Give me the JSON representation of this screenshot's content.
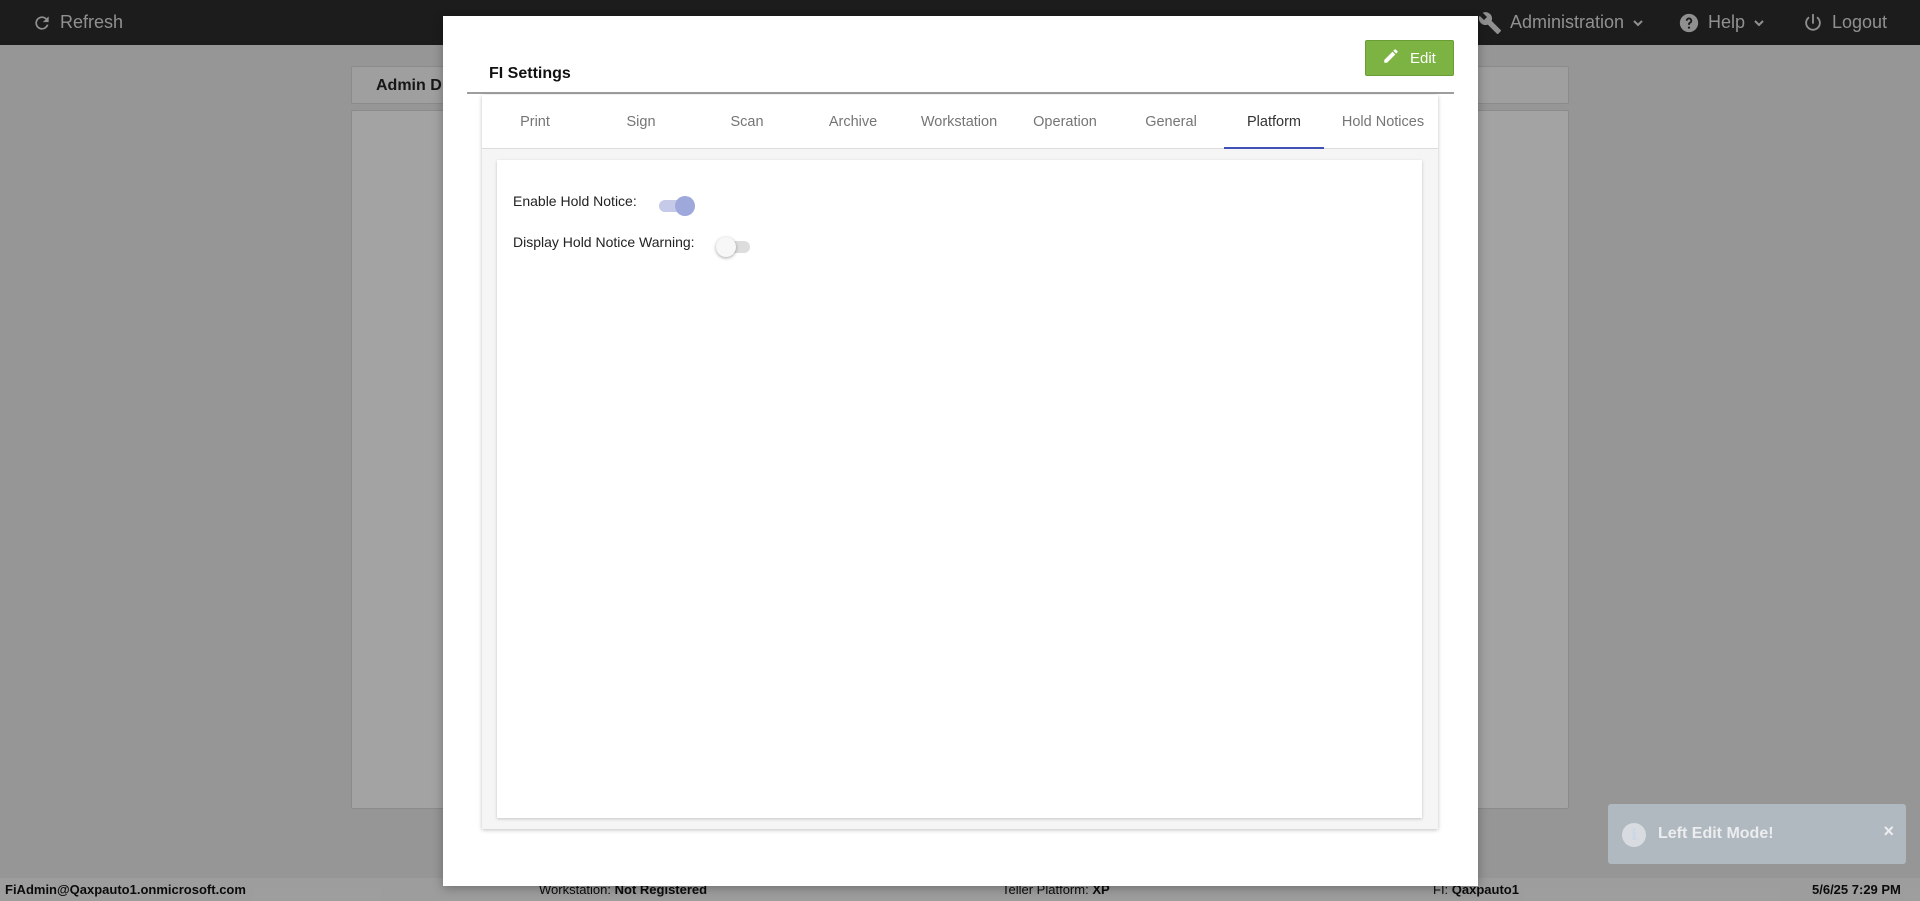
{
  "topbar": {
    "refresh_label": "Refresh",
    "administration_label": "Administration",
    "help_label": "Help",
    "logout_label": "Logout"
  },
  "background": {
    "header_title": "Admin D"
  },
  "footer": {
    "user": "FiAdmin@Qaxpauto1.onmicrosoft.com",
    "workstation_label": "Workstation:",
    "workstation_value": "Not Registered",
    "teller_label": "Teller Platform:",
    "teller_value": "XP",
    "fi_label": "FI:",
    "fi_value": "Qaxpauto1",
    "datetime": "5/6/25 7:29 PM"
  },
  "toast": {
    "message": "Left Edit Mode!",
    "info_glyph": "i",
    "close_glyph": "×"
  },
  "modal": {
    "title": "FI Settings",
    "edit_label": "Edit",
    "tabs": [
      {
        "label": "Print"
      },
      {
        "label": "Sign"
      },
      {
        "label": "Scan"
      },
      {
        "label": "Archive"
      },
      {
        "label": "Workstation"
      },
      {
        "label": "Operation"
      },
      {
        "label": "General"
      },
      {
        "label": "Platform"
      },
      {
        "label": "Hold Notices"
      }
    ],
    "active_tab": "Platform",
    "settings": [
      {
        "label": "Enable Hold Notice:",
        "enabled": true
      },
      {
        "label": "Display Hold Notice Warning:",
        "enabled": false
      }
    ]
  },
  "colors": {
    "topbar": "#2b2b2b",
    "edit_button": "#7cb342",
    "tab_indicator": "#3f51b5",
    "toggle_on": "#9fa8da"
  },
  "icons": [
    "refresh-icon",
    "wrench-icon",
    "help-icon",
    "power-icon",
    "pencil-icon",
    "info-icon",
    "close-icon",
    "chevron-down-icon"
  ]
}
